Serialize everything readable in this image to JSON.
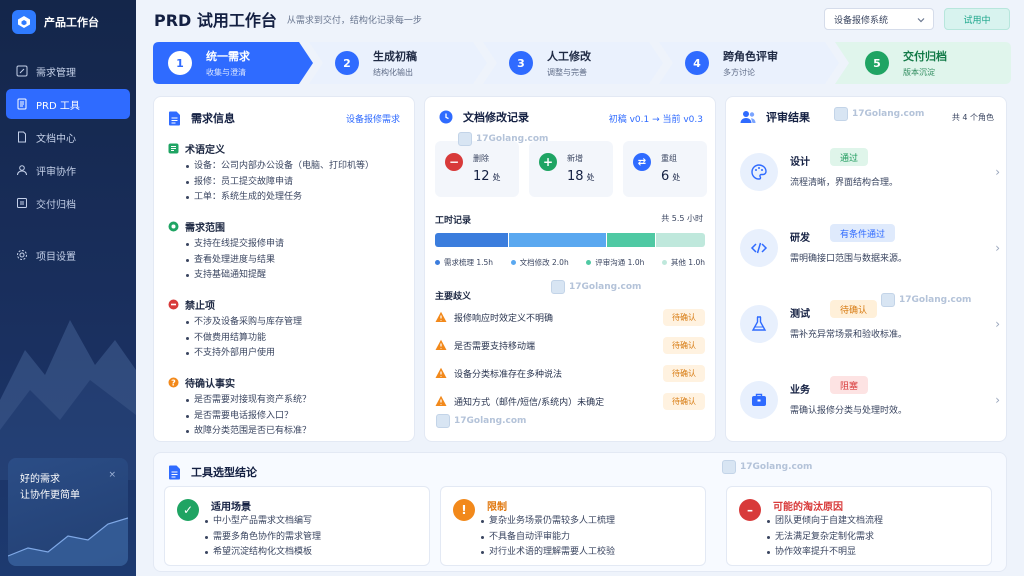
{
  "app": {
    "title": "产品工作台"
  },
  "sidebar": {
    "items": [
      {
        "label": "需求管理",
        "icon": "edit-icon"
      },
      {
        "label": "PRD 工具",
        "icon": "doc-icon"
      },
      {
        "label": "文档中心",
        "icon": "file-icon"
      },
      {
        "label": "评审协作",
        "icon": "users-icon"
      },
      {
        "label": "交付归档",
        "icon": "archive-icon"
      }
    ],
    "settings_label": "项目设置",
    "promo_line1": "好的需求",
    "promo_line2": "让协作更简单",
    "promo_close": "×"
  },
  "header": {
    "title": "PRD 试用工作台",
    "subtitle": "从需求到交付，结构化记录每一步",
    "system_select": "设备报修系统",
    "trial_badge": "试用中"
  },
  "steps": [
    {
      "num": "1",
      "title": "统一需求",
      "sub": "收集与澄清",
      "active": true
    },
    {
      "num": "2",
      "title": "生成初稿",
      "sub": "结构化输出"
    },
    {
      "num": "3",
      "title": "人工修改",
      "sub": "调整与完善"
    },
    {
      "num": "4",
      "title": "跨角色评审",
      "sub": "多方讨论"
    },
    {
      "num": "5",
      "title": "交付归档",
      "sub": "版本沉淀",
      "done": true
    }
  ],
  "requirements": {
    "title": "需求信息",
    "tag": "设备报修需求",
    "sections": [
      {
        "title": "术语定义",
        "items": [
          "设备：公司内部办公设备（电脑、打印机等）",
          "报修：员工提交故障申请",
          "工单：系统生成的处理任务"
        ]
      },
      {
        "title": "需求范围",
        "items": [
          "支持在线提交报修申请",
          "查看处理进度与结果",
          "支持基础通知提醒"
        ]
      },
      {
        "title": "禁止项",
        "items": [
          "不涉及设备采购与库存管理",
          "不做费用结算功能",
          "不支持外部用户使用"
        ]
      },
      {
        "title": "待确认事实",
        "items": [
          "是否需要对接现有资产系统？",
          "是否需要电话报修入口？",
          "故障分类范围是否已有标准？"
        ]
      }
    ]
  },
  "revisions": {
    "title": "文档修改记录",
    "version": "初稿 v0.1 → 当前 v0.3",
    "stats": [
      {
        "label": "删除",
        "value": "12",
        "unit": "处",
        "icon": "minus-icon"
      },
      {
        "label": "新增",
        "value": "18",
        "unit": "处",
        "icon": "plus-icon"
      },
      {
        "label": "重组",
        "value": "6",
        "unit": "处",
        "icon": "swap-icon"
      }
    ],
    "time_title": "工时记录",
    "time_total": "共 5.5 小时",
    "time_segments": [
      {
        "label": "需求梳理 1.5h",
        "hours": 1.5,
        "color": "#3b7ddd"
      },
      {
        "label": "文档修改 2.0h",
        "hours": 2.0,
        "color": "#5aa8f0"
      },
      {
        "label": "评审沟通 1.0h",
        "hours": 1.0,
        "color": "#4fc9a3"
      },
      {
        "label": "其他 1.0h",
        "hours": 1.0,
        "color": "#bfe8dc"
      }
    ],
    "issues_title": "主要歧义",
    "issues": [
      {
        "text": "报修响应时效定义不明确",
        "tag": "待确认"
      },
      {
        "text": "是否需要支持移动端",
        "tag": "待确认"
      },
      {
        "text": "设备分类标准存在多种说法",
        "tag": "待确认"
      },
      {
        "text": "通知方式（邮件/短信/系统内）未确定",
        "tag": "待确认"
      }
    ]
  },
  "review": {
    "title": "评审结果",
    "count": "共 4 个角色",
    "roles": [
      {
        "role": "设计",
        "status": "通过",
        "desc": "流程清晰，界面结构合理。",
        "bg": "#dff5ea",
        "fg": "#1d9a5c"
      },
      {
        "role": "研发",
        "status": "有条件通过",
        "desc": "需明确接口范围与数据来源。",
        "bg": "#dfeafc",
        "fg": "#2f6bff"
      },
      {
        "role": "测试",
        "status": "待确认",
        "desc": "需补充异常场景和验收标准。",
        "bg": "#fff0d9",
        "fg": "#d77a10"
      },
      {
        "role": "业务",
        "status": "阻塞",
        "desc": "需确认报修分类与处理时效。",
        "bg": "#fde3e3",
        "fg": "#d83a3a"
      }
    ]
  },
  "conclusion": {
    "title": "工具选型结论",
    "blocks": [
      {
        "title": "适用场景",
        "items": [
          "中小型产品需求文档编写",
          "需要多角色协作的需求管理",
          "希望沉淀结构化文档模板"
        ],
        "color": "#1fa463",
        "title_color": "#142042",
        "icon": "check-icon",
        "glyph": "✓"
      },
      {
        "title": "限制",
        "items": [
          "复杂业务场景仍需较多人工梳理",
          "不具备自动评审能力",
          "对行业术语的理解需要人工校验"
        ],
        "color": "#f2891b",
        "title_color": "#e0780f",
        "icon": "alert-icon",
        "glyph": "!"
      },
      {
        "title": "可能的淘汰原因",
        "items": [
          "团队更倾向于自建文档流程",
          "无法满足复杂定制化需求",
          "协作效率提升不明显"
        ],
        "color": "#d83a3a",
        "title_color": "#d83a3a",
        "icon": "minus-circle-icon",
        "glyph": "–"
      }
    ]
  },
  "watermark": "17Golang.com"
}
